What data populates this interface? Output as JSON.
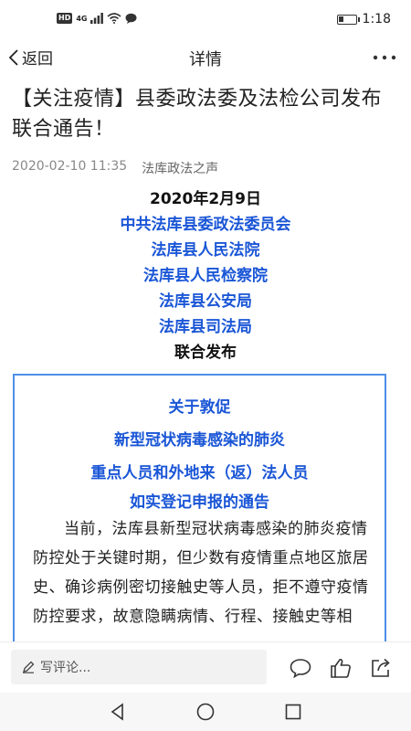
{
  "status_bar": {
    "hd_badge": "HD",
    "network": "4G",
    "battery_level": 0.3,
    "time": "1:18"
  },
  "header": {
    "back_label": "返回",
    "title": "详情"
  },
  "article": {
    "headline": "【关注疫情】县委政法委及法检公司发布联合通告！",
    "date": "2020-02-10 11:35",
    "source": "法库政法之声",
    "lines": [
      {
        "text": "2020年2月9日",
        "color": "#111111"
      },
      {
        "text": "中共法库县委政法委员会",
        "color": "#1a56d6"
      },
      {
        "text": "法库县人民法院",
        "color": "#1a56d6"
      },
      {
        "text": "法库县人民检察院",
        "color": "#1a56d6"
      },
      {
        "text": "法库县公安局",
        "color": "#1a56d6"
      },
      {
        "text": "法库县司法局",
        "color": "#1a56d6"
      },
      {
        "text": "联合发布",
        "color": "#111111"
      }
    ],
    "notice": {
      "title_lines": [
        "关于敦促",
        "新型冠状病毒感染的肺炎",
        "重点人员和外地来（返）法人员",
        "如实登记申报的通告"
      ],
      "body": "当前，法库县新型冠状病毒感染的肺炎疫情防控处于关键时期，但少数有疫情重点地区旅居史、确诊病例密切接触史等人员，拒不遵守疫情防控要求，故意隐瞒病情、行程、接触史等相"
    }
  },
  "comment_bar": {
    "placeholder": "写评论..."
  },
  "colors": {
    "accent_blue": "#1a56d6",
    "box_border": "#4d8fe8"
  }
}
